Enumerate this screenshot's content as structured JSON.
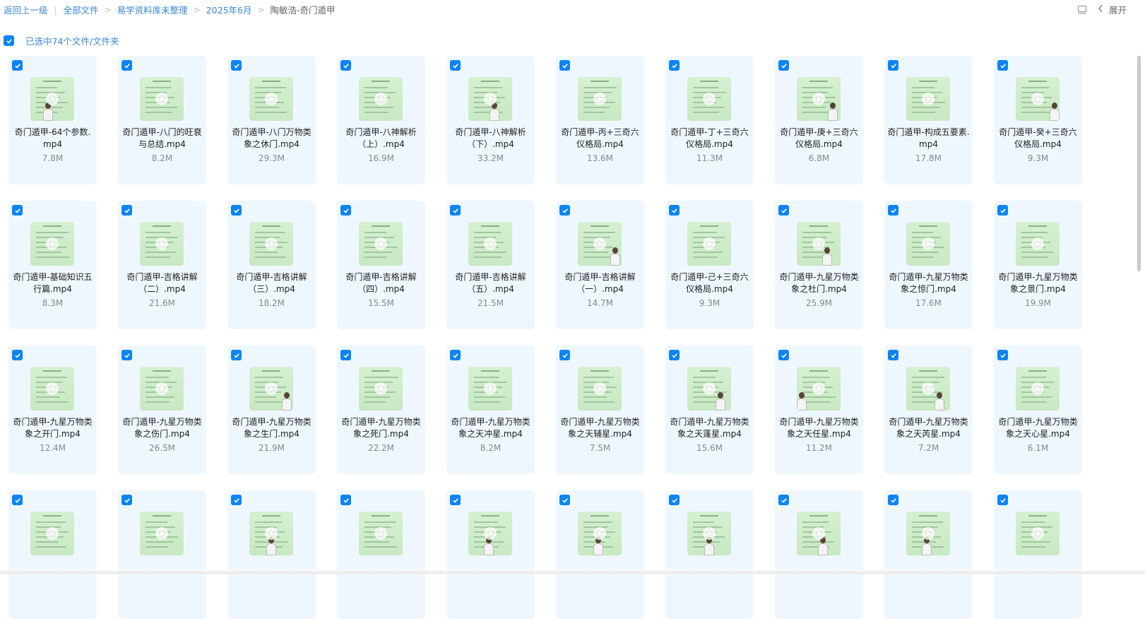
{
  "breadcrumb": {
    "back_label": "返回上一级",
    "items": [
      "全部文件",
      "易学资料库未整理",
      "2025年6月"
    ],
    "current": "陶敏浩-奇门遁甲"
  },
  "toolbar": {
    "expand_label": "展开"
  },
  "selection": {
    "text": "已选中74个文件/文件夹",
    "checked": true
  },
  "files": [
    {
      "name": "奇门遁甲-64个参数.mp4",
      "size": "7.8M"
    },
    {
      "name": "奇门遁甲-八门的旺衰与总结.mp4",
      "size": "8.2M"
    },
    {
      "name": "奇门遁甲-八门万物类象之休门.mp4",
      "size": "29.3M"
    },
    {
      "name": "奇门遁甲-八神解析（上）.mp4",
      "size": "16.9M"
    },
    {
      "name": "奇门遁甲-八神解析（下）.mp4",
      "size": "33.2M"
    },
    {
      "name": "奇门遁甲-丙+三奇六仪格局.mp4",
      "size": "13.6M"
    },
    {
      "name": "奇门遁甲-丁+三奇六仪格局.mp4",
      "size": "11.3M"
    },
    {
      "name": "奇门遁甲-庚+三奇六仪格局.mp4",
      "size": "6.8M"
    },
    {
      "name": "奇门遁甲-构成五要素.mp4",
      "size": "17.8M"
    },
    {
      "name": "奇门遁甲-癸+三奇六仪格局.mp4",
      "size": "9.3M"
    },
    {
      "name": "奇门遁甲-基础知识五行篇.mp4",
      "size": "8.3M"
    },
    {
      "name": "奇门遁甲-吉格讲解（二）.mp4",
      "size": "21.6M"
    },
    {
      "name": "奇门遁甲-吉格讲解（三）.mp4",
      "size": "18.2M"
    },
    {
      "name": "奇门遁甲-吉格讲解（四）.mp4",
      "size": "15.5M"
    },
    {
      "name": "奇门遁甲-吉格讲解（五）.mp4",
      "size": "21.5M"
    },
    {
      "name": "奇门遁甲-吉格讲解（一）.mp4",
      "size": "14.7M"
    },
    {
      "name": "奇门遁甲-己+三奇六仪格局.mp4",
      "size": "9.3M"
    },
    {
      "name": "奇门遁甲-九星万物类象之杜门.mp4",
      "size": "25.9M"
    },
    {
      "name": "奇门遁甲-九星万物类象之惊门.mp4",
      "size": "17.6M"
    },
    {
      "name": "奇门遁甲-九星万物类象之景门.mp4",
      "size": "19.9M"
    },
    {
      "name": "奇门遁甲-九星万物类象之开门.mp4",
      "size": "12.4M"
    },
    {
      "name": "奇门遁甲-九星万物类象之伤门.mp4",
      "size": "26.5M"
    },
    {
      "name": "奇门遁甲-九星万物类象之生门.mp4",
      "size": "21.9M"
    },
    {
      "name": "奇门遁甲-九星万物类象之死门.mp4",
      "size": "22.2M"
    },
    {
      "name": "奇门遁甲-九星万物类象之天冲星.mp4",
      "size": "8.2M"
    },
    {
      "name": "奇门遁甲-九星万物类象之天辅星.mp4",
      "size": "7.5M"
    },
    {
      "name": "奇门遁甲-九星万物类象之天蓬星.mp4",
      "size": "15.6M"
    },
    {
      "name": "奇门遁甲-九星万物类象之天任星.mp4",
      "size": "11.2M"
    },
    {
      "name": "奇门遁甲-九星万物类象之天芮星.mp4",
      "size": "7.2M"
    },
    {
      "name": "奇门遁甲-九星万物类象之天心星.mp4",
      "size": "6.1M"
    },
    {
      "name": "",
      "size": ""
    },
    {
      "name": "",
      "size": ""
    },
    {
      "name": "",
      "size": ""
    },
    {
      "name": "",
      "size": ""
    },
    {
      "name": "",
      "size": ""
    },
    {
      "name": "",
      "size": ""
    },
    {
      "name": "",
      "size": ""
    },
    {
      "name": "",
      "size": ""
    },
    {
      "name": "",
      "size": ""
    },
    {
      "name": "",
      "size": ""
    }
  ],
  "colors": {
    "accent": "#0d84f5",
    "link": "#3a86d6",
    "card_bg": "#eff7fe",
    "thumb_bg": "#d0edcb"
  },
  "icons": {
    "checkbox": "check-icon",
    "play": "play-icon",
    "view": "list-view-icon",
    "expand": "chevron-left-icon"
  }
}
